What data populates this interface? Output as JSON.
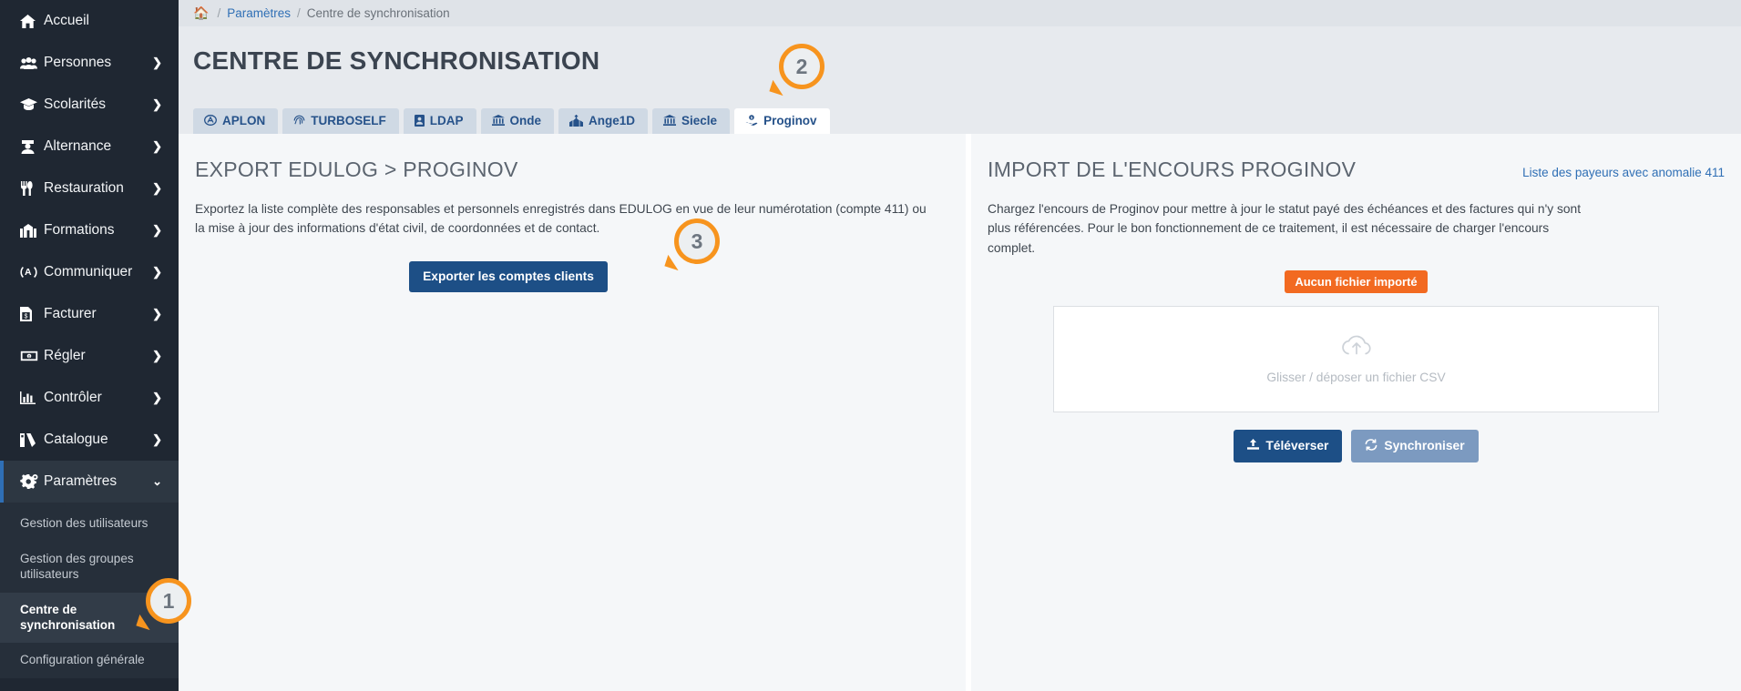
{
  "sidebar": {
    "items": [
      {
        "label": "Accueil",
        "icon": "home-icon",
        "chevron": false
      },
      {
        "label": "Personnes",
        "icon": "people-icon",
        "chevron": true
      },
      {
        "label": "Scolarités",
        "icon": "graduation-cap-icon",
        "chevron": true
      },
      {
        "label": "Alternance",
        "icon": "user-tie-icon",
        "chevron": true
      },
      {
        "label": "Restauration",
        "icon": "utensils-icon",
        "chevron": true
      },
      {
        "label": "Formations",
        "icon": "school-icon",
        "chevron": true
      },
      {
        "label": "Communiquer",
        "icon": "broadcast-icon",
        "chevron": true
      },
      {
        "label": "Facturer",
        "icon": "invoice-icon",
        "chevron": true
      },
      {
        "label": "Régler",
        "icon": "money-bill-icon",
        "chevron": true
      },
      {
        "label": "Contrôler",
        "icon": "chart-bar-icon",
        "chevron": true
      },
      {
        "label": "Catalogue",
        "icon": "catalog-icon",
        "chevron": true
      },
      {
        "label": "Paramètres",
        "icon": "gears-icon",
        "chevron": true,
        "active": true
      }
    ],
    "submenu": [
      {
        "label": "Gestion des utilisateurs",
        "active": false
      },
      {
        "label": "Gestion des groupes utilisateurs",
        "active": false
      },
      {
        "label": "Centre de synchronisation",
        "active": true
      },
      {
        "label": "Configuration générale",
        "active": false
      }
    ]
  },
  "breadcrumb": {
    "home_icon": "home-icon",
    "parent": "Paramètres",
    "current": "Centre de synchronisation"
  },
  "header": {
    "title": "CENTRE DE SYNCHRONISATION"
  },
  "tabs": [
    {
      "label": "APLON",
      "icon": "aplon-icon",
      "active": false
    },
    {
      "label": "TURBOSELF",
      "icon": "fingerprint-icon",
      "active": false
    },
    {
      "label": "LDAP",
      "icon": "id-card-icon",
      "active": false
    },
    {
      "label": "Onde",
      "icon": "bank-icon",
      "active": false
    },
    {
      "label": "Ange1D",
      "icon": "church-icon",
      "active": false
    },
    {
      "label": "Siecle",
      "icon": "bank-icon",
      "active": false
    },
    {
      "label": "Proginov",
      "icon": "hand-coin-icon",
      "active": true
    }
  ],
  "export_panel": {
    "title": "EXPORT EDULOG > PROGINOV",
    "description": "Exportez la liste complète des responsables et personnels enregistrés dans EDULOG en vue de leur numérotation (compte 411) ou la mise à jour des informations d'état civil, de coordonnées et de contact.",
    "button_label": "Exporter les comptes clients"
  },
  "import_panel": {
    "title": "IMPORT DE L'ENCOURS PROGINOV",
    "link_label": "Liste des payeurs avec anomalie 411",
    "description": "Chargez l'encours de Proginov pour mettre à jour le statut payé des échéances et des factures qui n'y sont plus référencées. Pour le bon fonctionnement de ce traitement, il est nécessaire de charger l'encours complet.",
    "status_badge": "Aucun fichier importé",
    "dropzone_icon": "cloud-upload-icon",
    "dropzone_text": "Glisser / déposer un fichier CSV",
    "upload_button": "Téléverser",
    "upload_icon": "upload-icon",
    "sync_button": "Synchroniser",
    "sync_icon": "sync-icon"
  },
  "callouts": [
    {
      "number": "1"
    },
    {
      "number": "2"
    },
    {
      "number": "3"
    }
  ],
  "colors": {
    "sidebar_bg": "#1f2732",
    "accent_blue": "#2f6fb5",
    "primary_button": "#1d4f86",
    "muted_button": "#7c9ac0",
    "badge_orange": "#f26a21",
    "callout_orange": "#f7941e"
  }
}
